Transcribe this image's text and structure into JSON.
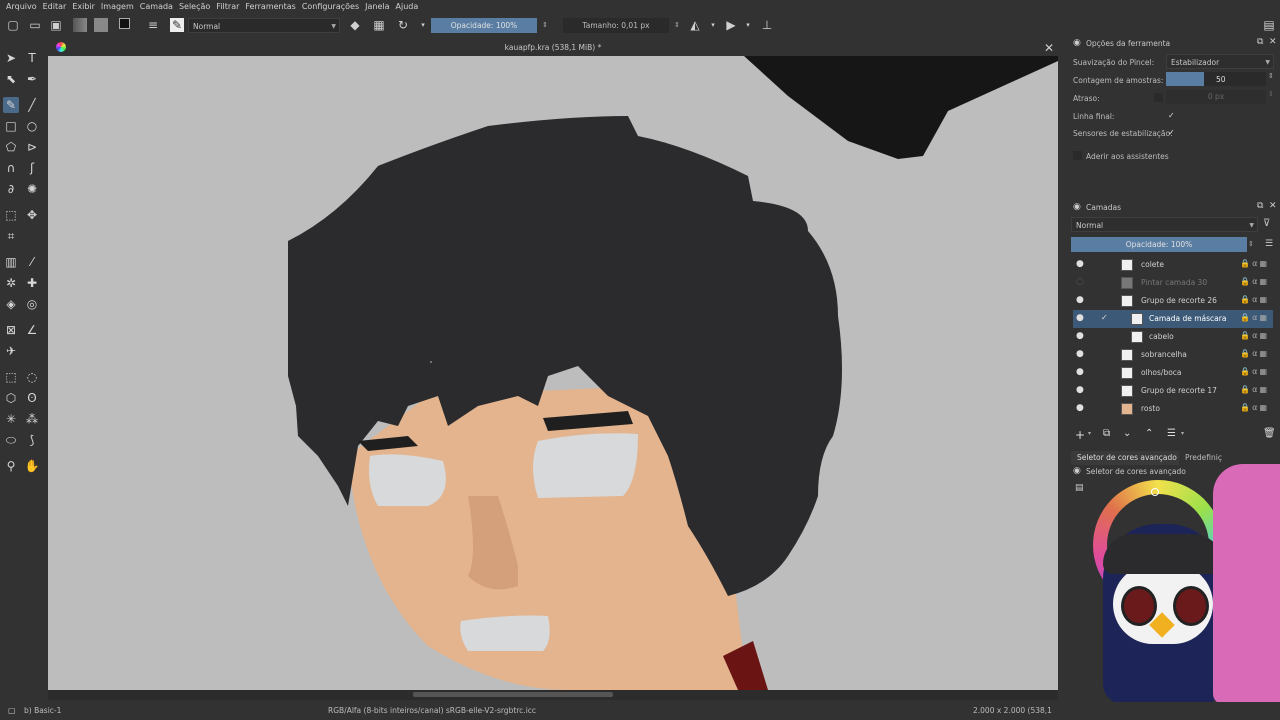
{
  "menu": [
    "Arquivo",
    "Editar",
    "Exibir",
    "Imagem",
    "Camada",
    "Seleção",
    "Filtrar",
    "Ferramentas",
    "Configurações",
    "Janela",
    "Ajuda"
  ],
  "toolbar": {
    "blend_mode": "Normal",
    "opacity": "Opacidade: 100%",
    "size": "Tamanho: 0,01 px"
  },
  "document": {
    "title": "kauapfp.kra (538,1 MiB) *"
  },
  "tool_options": {
    "title": "Opções da ferramenta",
    "smoothing_label": "Suavização do Pincel:",
    "smoothing_value": "Estabilizador",
    "sample_count_label": "Contagem de amostras:",
    "sample_count_value": "50",
    "delay_label": "Atraso:",
    "delay_value": "0 px",
    "finish_line_label": "Linha final:",
    "stabilize_sensors_label": "Sensores de estabilização:",
    "snap_assistants_label": "Aderir aos assistentes"
  },
  "layers": {
    "title": "Camadas",
    "blend_mode": "Normal",
    "opacity": "Opacidade: 100%",
    "items": [
      {
        "name": "colete",
        "selected": false
      },
      {
        "name": "Pintar camada 30",
        "selected": false
      },
      {
        "name": "Grupo de recorte 26",
        "selected": false
      },
      {
        "name": "Camada de máscara",
        "selected": true
      },
      {
        "name": "cabelo",
        "selected": false
      },
      {
        "name": "sobrancelha",
        "selected": false
      },
      {
        "name": "olhos/boca",
        "selected": false
      },
      {
        "name": "Grupo de recorte 17",
        "selected": false
      },
      {
        "name": "rosto",
        "selected": false
      }
    ]
  },
  "color_selector": {
    "tab1": "Seletor de cores avançado",
    "tab2": "Predefiniç",
    "title": "Seletor de cores avançado"
  },
  "status": {
    "brush": "b) Basic-1",
    "color_info": "RGB/Alfa (8-bits inteiros/canal)  sRGB-elle-V2-srgbtrc.icc",
    "dimensions": "2.000 x 2.000 (538,1"
  },
  "colors": {
    "accent": "#5a7ea3",
    "canvas_bg": "#bdbdbd",
    "hair": "#2b2b2d",
    "skin": "#e3b48e"
  }
}
